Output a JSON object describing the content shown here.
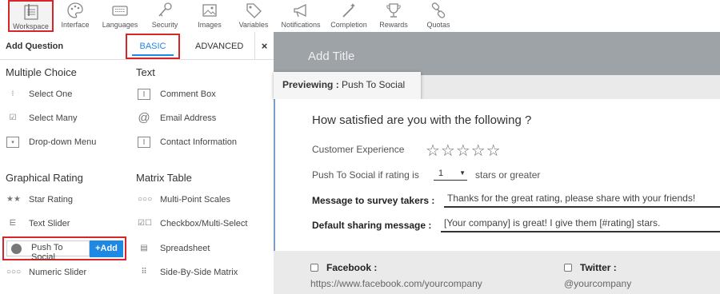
{
  "toolbar": {
    "items": [
      {
        "label": "Workspace",
        "icon": "workspace-icon"
      },
      {
        "label": "Interface",
        "icon": "palette-icon"
      },
      {
        "label": "Languages",
        "icon": "keyboard-icon"
      },
      {
        "label": "Security",
        "icon": "key-icon"
      },
      {
        "label": "Images",
        "icon": "image-icon"
      },
      {
        "label": "Variables",
        "icon": "tag-icon"
      },
      {
        "label": "Notifications",
        "icon": "megaphone-icon"
      },
      {
        "label": "Completion",
        "icon": "magic-wand-icon"
      },
      {
        "label": "Rewards",
        "icon": "trophy-icon"
      },
      {
        "label": "Quotas",
        "icon": "chain-icon"
      }
    ]
  },
  "left_panel": {
    "title": "Add Question",
    "tab_basic": "BASIC",
    "tab_advanced": "ADVANCED",
    "close": "×",
    "sections": {
      "multiple_choice": {
        "title": "Multiple Choice",
        "items": [
          "Select One",
          "Select Many",
          "Drop-down Menu"
        ]
      },
      "text": {
        "title": "Text",
        "items": [
          "Comment Box",
          "Email Address",
          "Contact Information"
        ]
      },
      "graphical_rating": {
        "title": "Graphical Rating",
        "items": [
          "Star Rating",
          "Text Slider",
          "Push To Social",
          "Numeric Slider"
        ]
      },
      "matrix_table": {
        "title": "Matrix Table",
        "items": [
          "Multi-Point Scales",
          "Checkbox/Multi-Select",
          "Spreadsheet",
          "Side-By-Side Matrix"
        ]
      }
    },
    "add_button": "+Add"
  },
  "preview": {
    "add_title": "Add Title",
    "previewing_label": "Previewing :",
    "previewing_value": "Push To Social",
    "question": "How satisfied are you with the following ?",
    "customer_experience": "Customer Experience",
    "stars": "☆☆☆☆☆",
    "rating_prefix": "Push To Social if rating is",
    "rating_value": "1",
    "rating_suffix": "stars or greater",
    "message_label": "Message to survey takers :",
    "message_value": "Thanks for the great rating, please share with your friends!",
    "default_label": "Default sharing message :",
    "default_value": "[Your company] is great! I give them [#rating] stars.",
    "facebook_label": "Facebook :",
    "facebook_value": "https://www.facebook.com/yourcompany",
    "twitter_label": "Twitter :",
    "twitter_value": "@yourcompany"
  }
}
